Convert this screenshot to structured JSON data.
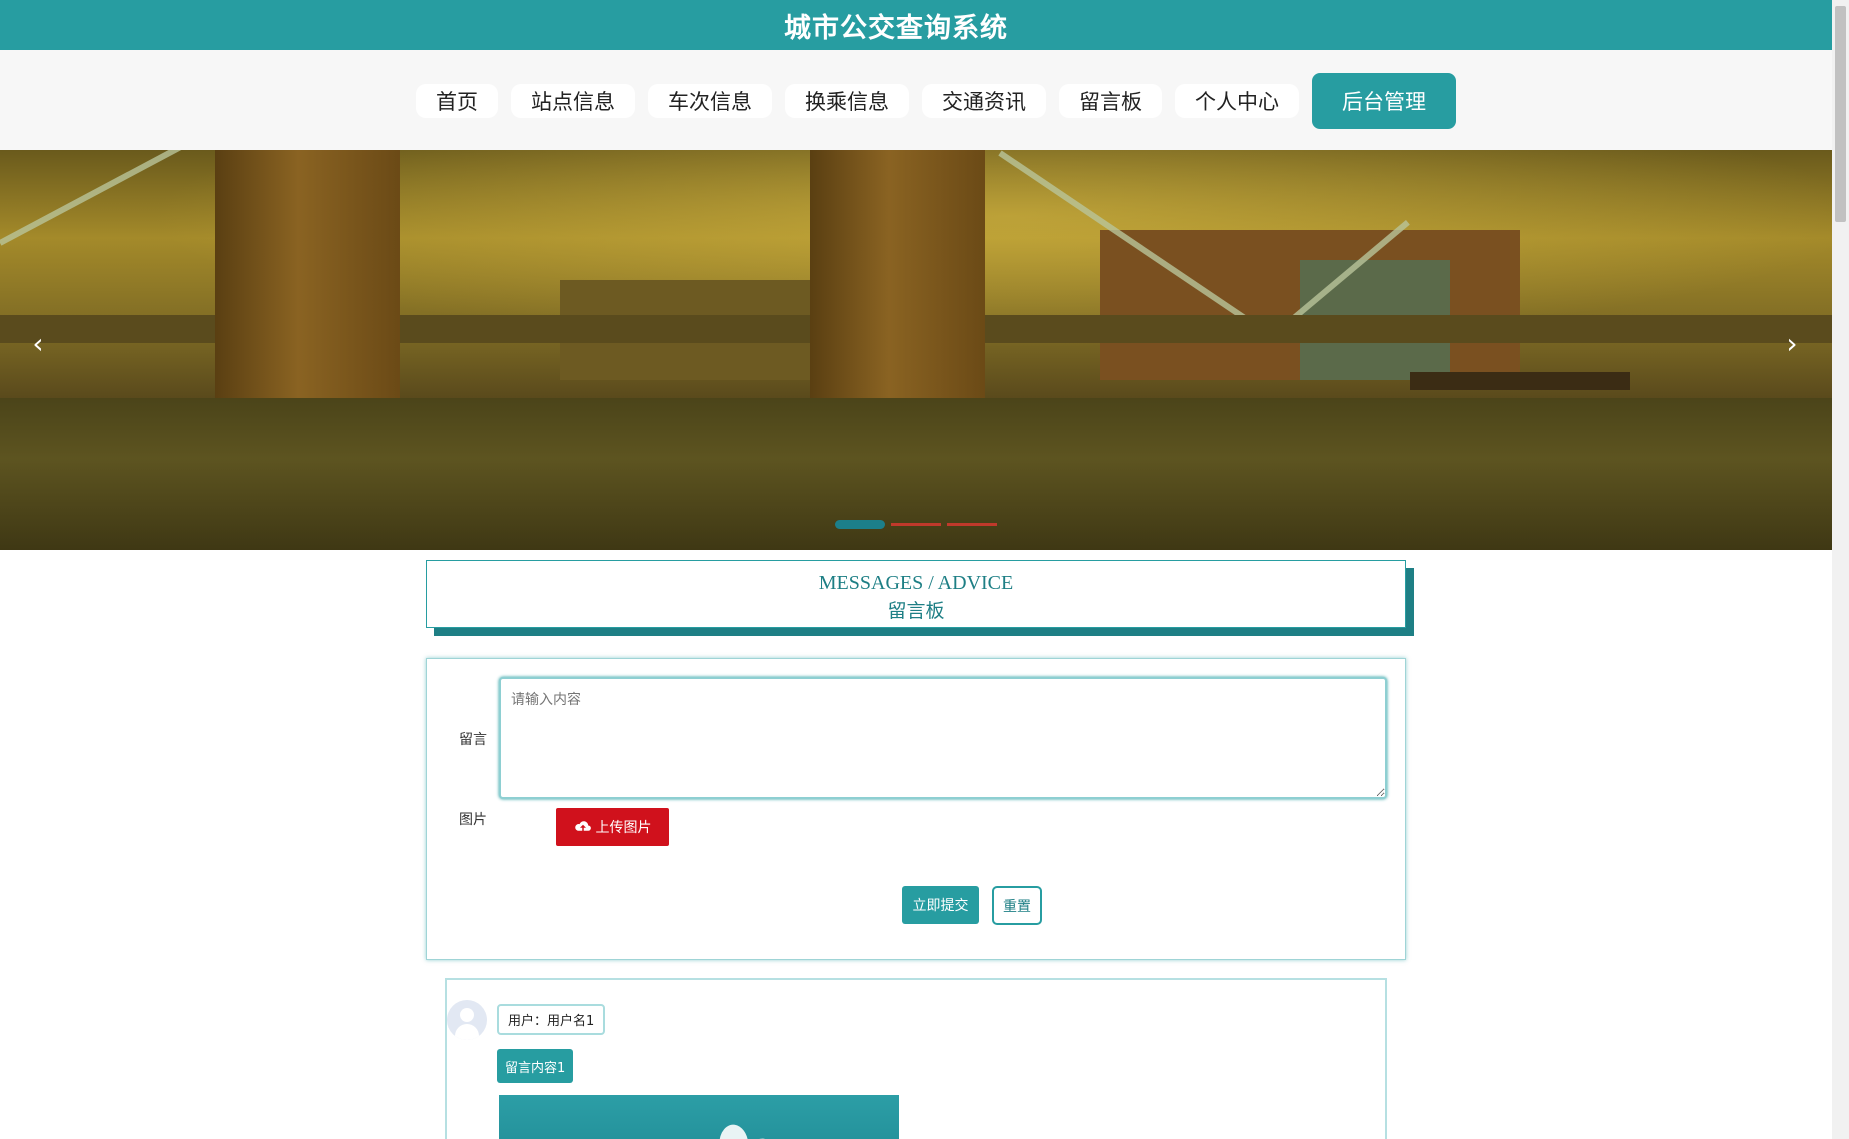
{
  "header": {
    "title": "城市公交查询系统"
  },
  "nav": {
    "items": [
      {
        "label": "首页"
      },
      {
        "label": "站点信息"
      },
      {
        "label": "车次信息"
      },
      {
        "label": "换乘信息"
      },
      {
        "label": "交通资讯"
      },
      {
        "label": "留言板"
      },
      {
        "label": "个人中心"
      }
    ],
    "admin_label": "后台管理"
  },
  "banner": {
    "prev_icon": "chevron-left-icon",
    "next_icon": "chevron-right-icon",
    "prev_glyph": "‹",
    "next_glyph": "›",
    "slide_count": 3,
    "active_slide": 1
  },
  "section": {
    "title_en": "MESSAGES / ADVICE",
    "title_cn": "留言板"
  },
  "form": {
    "message_label": "留言",
    "message_placeholder": "请输入内容",
    "image_label": "图片",
    "upload_label": "上传图片",
    "upload_icon": "cloud-upload-icon",
    "submit_label": "立即提交",
    "reset_label": "重置"
  },
  "messages": [
    {
      "user": "用户：用户名1",
      "content": "留言内容1"
    }
  ],
  "colors": {
    "primary": "#279da1",
    "danger": "#d0111c",
    "nav_bg": "#f7f7f7"
  }
}
